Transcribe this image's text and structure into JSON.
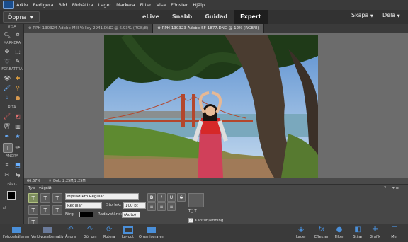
{
  "menubar": {
    "items": [
      "Arkiv",
      "Redigera",
      "Bild",
      "Förbättra",
      "Lager",
      "Markera",
      "Filter",
      "Visa",
      "Fönster",
      "Hjälp"
    ]
  },
  "topbar": {
    "open_label": "Öppna",
    "modes": [
      "eLive",
      "Snabb",
      "Guidad",
      "Expert"
    ],
    "active_mode": "Expert",
    "create_label": "Skapa",
    "share_label": "Dela"
  },
  "tabs": [
    {
      "label": "RPH-130324-Adobe-Mill-Valley-2941.DNG @ 6.93% (RGB/8)"
    },
    {
      "label": "RPH-130323-Adobe-SF-1877.DNG @ 12% (RGB/8)"
    }
  ],
  "toolbox": {
    "sections": [
      "VISA",
      "MARKERA",
      "FÖRBÄTTRA",
      "RITA",
      "ÄNDRA",
      "FÄRG"
    ]
  },
  "statusbar": {
    "zoom": "66.67%",
    "doc": "Dok: 2.25M/2.25M"
  },
  "options": {
    "title": "Typ - vågrät",
    "font": "Myriad Pro Regular",
    "style": "Regular",
    "size_label": "Storlek:",
    "size_value": "100 pt",
    "color_label": "Färg:",
    "leading_label": "Radavstånd:",
    "leading_value": "(Auto)",
    "antialias_label": "Kantutjämning",
    "bold": "B",
    "italic": "I",
    "underline": "U",
    "strike": "S"
  },
  "bottombar": {
    "left": [
      "Fotobehållaren",
      "Verktygsalternativ",
      "Ångra",
      "Gör om",
      "Rotera",
      "Layout",
      "Organiseraren"
    ],
    "right": [
      "Lager",
      "Effekter",
      "Filter",
      "Stilar",
      "Grafik",
      "Mer"
    ]
  },
  "colors": {
    "active_mode_bg": "#1e1e1e",
    "accent": "#4a8fd9"
  }
}
